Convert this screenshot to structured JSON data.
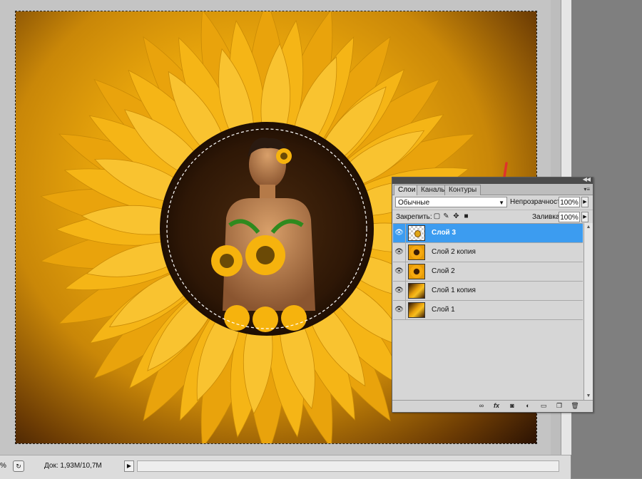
{
  "status_bar": {
    "zoom": "%",
    "doc_info": "Док: 1,93M/10,7M"
  },
  "layers_panel": {
    "tabs": [
      {
        "label": "Слои",
        "active": true
      },
      {
        "label": "Каналы",
        "active": false
      },
      {
        "label": "Контуры",
        "active": false
      }
    ],
    "blend_mode": "Обычные",
    "opacity_label": "Непрозрачность:",
    "opacity_value": "100%",
    "lock_label": "Закрепить:",
    "fill_label": "Заливка:",
    "fill_value": "100%",
    "layers": [
      {
        "name": "Слой 3",
        "thumbnail": "transparent-with-flower-icon",
        "selected": true
      },
      {
        "name": "Слой 2 копия",
        "thumbnail": "sunflower-icon",
        "selected": false
      },
      {
        "name": "Слой 2",
        "thumbnail": "sunflower-icon",
        "selected": false
      },
      {
        "name": "Слой 1 копия",
        "thumbnail": "gradient-icon",
        "selected": false
      },
      {
        "name": "Слой 1",
        "thumbnail": "gradient-icon",
        "selected": false
      }
    ],
    "footer_icons": [
      "link-icon",
      "fx-icon",
      "mask-icon",
      "adjustment-icon",
      "folder-icon",
      "new-layer-icon",
      "trash-icon"
    ]
  },
  "colors": {
    "selection_blue": "#3c9cf0",
    "petal_yellow": "#f7b616",
    "arrow_red": "#e0332b"
  }
}
